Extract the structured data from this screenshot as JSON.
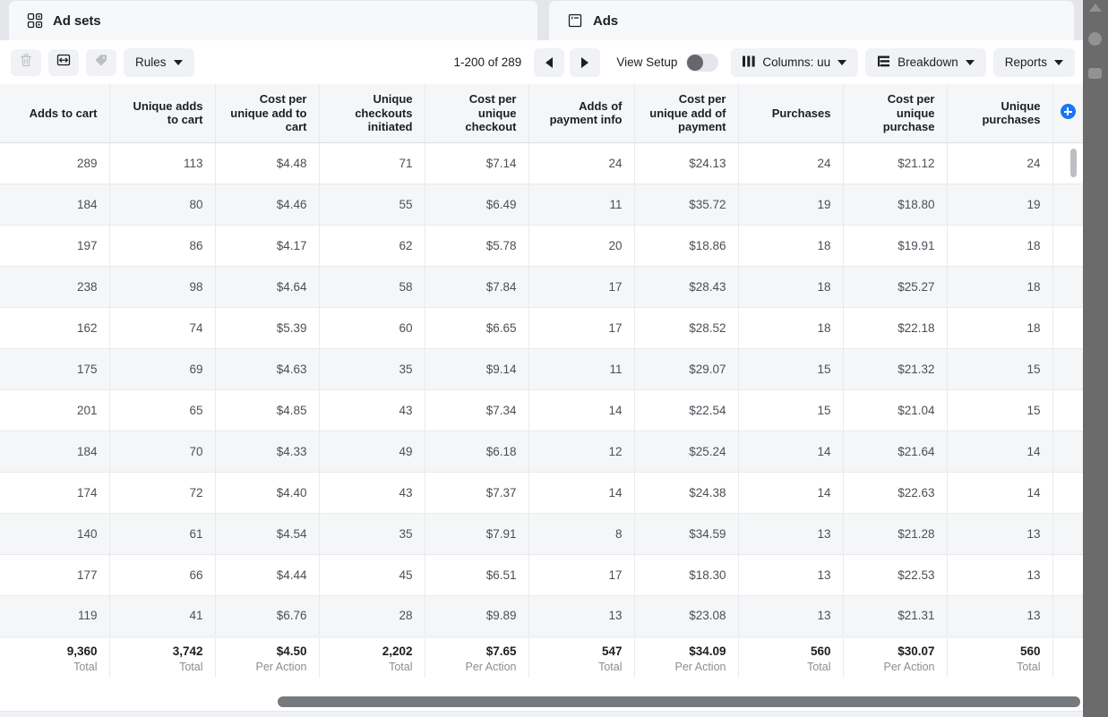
{
  "tabs": [
    {
      "label": "Ad sets",
      "icon": "grid-icon",
      "active": true
    },
    {
      "label": "Ads",
      "icon": "ad-card-icon",
      "active": false
    }
  ],
  "toolbar": {
    "delete_icon": "trash-icon",
    "duplicate_icon": "duplicate-icon",
    "tag_icon": "tag-icon",
    "rules_label": "Rules",
    "pagination_text": "1-200 of 289",
    "prev_icon": "chevron-left-icon",
    "next_icon": "chevron-right-icon",
    "view_setup_label": "View Setup",
    "view_setup_on": false,
    "columns_label": "Columns: uu",
    "columns_icon": "columns-icon",
    "breakdown_label": "Breakdown",
    "breakdown_icon": "breakdown-icon",
    "reports_label": "Reports",
    "add_column_icon": "plus-circle-icon",
    "accent_color": "#1877f2"
  },
  "table": {
    "columns": [
      "Adds to cart",
      "Unique adds to cart",
      "Cost per unique add to cart",
      "Unique checkouts initiated",
      "Cost per unique checkout",
      "Adds of payment info",
      "Cost per unique add of payment",
      "Purchases",
      "Cost per unique purchase",
      "Unique purchases"
    ],
    "rows": [
      [
        "289",
        "113",
        "$4.48",
        "71",
        "$7.14",
        "24",
        "$24.13",
        "24",
        "$21.12",
        "24"
      ],
      [
        "184",
        "80",
        "$4.46",
        "55",
        "$6.49",
        "11",
        "$35.72",
        "19",
        "$18.80",
        "19"
      ],
      [
        "197",
        "86",
        "$4.17",
        "62",
        "$5.78",
        "20",
        "$18.86",
        "18",
        "$19.91",
        "18"
      ],
      [
        "238",
        "98",
        "$4.64",
        "58",
        "$7.84",
        "17",
        "$28.43",
        "18",
        "$25.27",
        "18"
      ],
      [
        "162",
        "74",
        "$5.39",
        "60",
        "$6.65",
        "17",
        "$28.52",
        "18",
        "$22.18",
        "18"
      ],
      [
        "175",
        "69",
        "$4.63",
        "35",
        "$9.14",
        "11",
        "$29.07",
        "15",
        "$21.32",
        "15"
      ],
      [
        "201",
        "65",
        "$4.85",
        "43",
        "$7.34",
        "14",
        "$22.54",
        "15",
        "$21.04",
        "15"
      ],
      [
        "184",
        "70",
        "$4.33",
        "49",
        "$6.18",
        "12",
        "$25.24",
        "14",
        "$21.64",
        "14"
      ],
      [
        "174",
        "72",
        "$4.40",
        "43",
        "$7.37",
        "14",
        "$24.38",
        "14",
        "$22.63",
        "14"
      ],
      [
        "140",
        "61",
        "$4.54",
        "35",
        "$7.91",
        "8",
        "$34.59",
        "13",
        "$21.28",
        "13"
      ],
      [
        "177",
        "66",
        "$4.44",
        "45",
        "$6.51",
        "17",
        "$18.30",
        "13",
        "$22.53",
        "13"
      ],
      [
        "119",
        "41",
        "$6.76",
        "28",
        "$9.89",
        "13",
        "$23.08",
        "13",
        "$21.31",
        "13"
      ]
    ],
    "totals_values": [
      "9,360",
      "3,742",
      "$4.50",
      "2,202",
      "$7.65",
      "547",
      "$34.09",
      "560",
      "$30.07",
      "560"
    ],
    "totals_labels": [
      "Total",
      "Total",
      "Per Action",
      "Total",
      "Per Action",
      "Total",
      "Per Action",
      "Total",
      "Per Action",
      "Total"
    ]
  }
}
